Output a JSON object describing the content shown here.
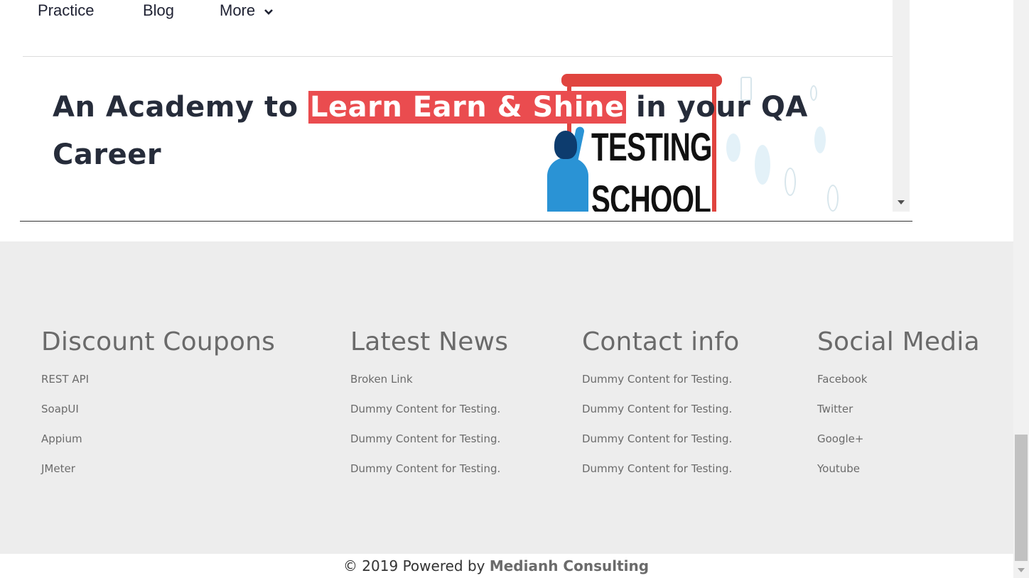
{
  "nav": {
    "items": [
      "Practice",
      "Blog",
      "More"
    ]
  },
  "hero": {
    "title_before": "An Academy to ",
    "title_highlight": "Learn Earn & Shine",
    "title_after": "  in your QA Career",
    "highlight_color": "#ea4c4f",
    "illustration_text_1": "TESTING",
    "illustration_text_2": "SCHOOL"
  },
  "footer": {
    "columns": [
      {
        "heading": "Discount Coupons",
        "links": [
          "REST API",
          "SoapUI",
          "Appium",
          "JMeter"
        ]
      },
      {
        "heading": "Latest News",
        "links": [
          "Broken Link",
          "Dummy Content for Testing.",
          "Dummy Content for Testing.",
          "Dummy Content for Testing."
        ]
      },
      {
        "heading": "Contact info",
        "links": [
          "Dummy Content for Testing.",
          "Dummy Content for Testing.",
          "Dummy Content for Testing.",
          "Dummy Content for Testing."
        ]
      },
      {
        "heading": "Social Media",
        "links": [
          "Facebook",
          "Twitter",
          "Google+",
          "Youtube"
        ]
      }
    ],
    "background": "#ededed"
  },
  "copyright": {
    "prefix": "© 2019 Powered by ",
    "company": "Medianh Consulting"
  }
}
